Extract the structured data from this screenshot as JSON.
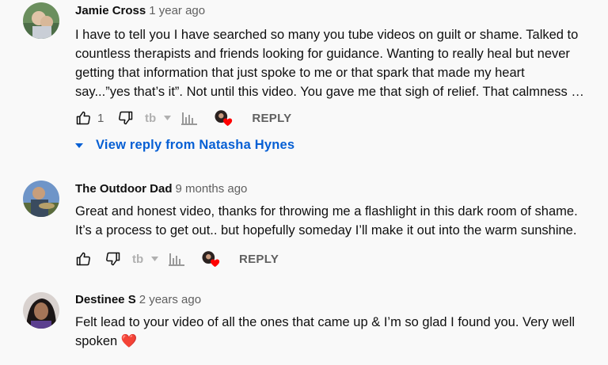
{
  "comments": [
    {
      "author": "Jamie Cross",
      "time": "1 year ago",
      "text_lines": [
        "I have to tell you I have searched so many you tube videos on guilt or shame. Talked to",
        "countless therapists and friends looking for guidance. Wanting to really heal but never",
        "getting that information that just spoke to me or that spark that made my heart",
        "say...”yes that’s it”. Not until this video. You gave me that sigh of relief. That calmness …"
      ],
      "like_count": "1",
      "reply_label": "REPLY",
      "view_reply_label": "View reply from Natasha Hynes"
    },
    {
      "author": "The Outdoor Dad",
      "time": "9 months ago",
      "text_lines": [
        "Great and honest video, thanks for throwing me a flashlight in this dark room of shame.",
        "It’s a process to get out.. but hopefully someday I’ll make it out into the warm sunshine."
      ],
      "reply_label": "REPLY"
    },
    {
      "author": "Destinee S",
      "time": "2 years ago",
      "text_lines": [
        "Felt lead to your video of all the ones that came up & I’m so glad I found you. Very well",
        "spoken ❤️"
      ]
    }
  ],
  "icons": {
    "like": "thumbs-up-icon",
    "dislike": "thumbs-down-icon",
    "extension": "tubebuddy-icon",
    "stats": "bar-chart-icon",
    "heart": "creator-heart-icon",
    "expand": "caret-down-icon"
  },
  "colors": {
    "link_blue": "#065fd4",
    "heart_red": "#ff0000",
    "meta_gray": "#606060",
    "background": "#f9f9f9"
  }
}
